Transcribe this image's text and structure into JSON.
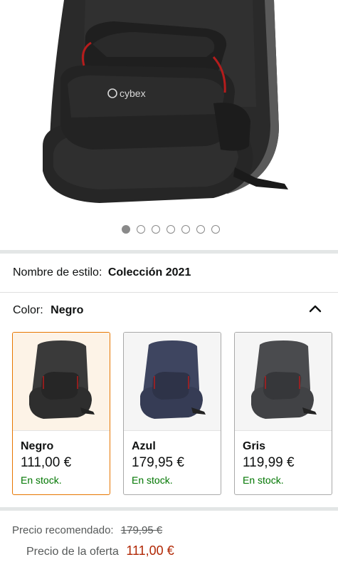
{
  "gallery": {
    "image_count": 7,
    "active_index": 0,
    "brand_logo": "cybex"
  },
  "style": {
    "label": "Nombre de estilo:",
    "value": "Colección 2021"
  },
  "color": {
    "label": "Color:",
    "value": "Negro",
    "toggle_icon": "chevron-up-icon"
  },
  "swatches": [
    {
      "name": "Negro",
      "price": "111,00 €",
      "stock": "En stock.",
      "selected": true,
      "seat_color": "#3a3a3a"
    },
    {
      "name": "Azul",
      "price": "179,95 €",
      "stock": "En stock.",
      "selected": false,
      "seat_color": "#3e4560"
    },
    {
      "name": "Gris",
      "price": "119,99 €",
      "stock": "En stock.",
      "selected": false,
      "seat_color": "#4a4b4e"
    }
  ],
  "pricing": {
    "recommended_label": "Precio recomendado:",
    "recommended_value": "179,95 €",
    "offer_label": "Precio de la oferta",
    "offer_value": "111,00 €"
  },
  "colors": {
    "accent_border": "#e77600",
    "in_stock": "#007600",
    "price_red": "#b12704"
  }
}
